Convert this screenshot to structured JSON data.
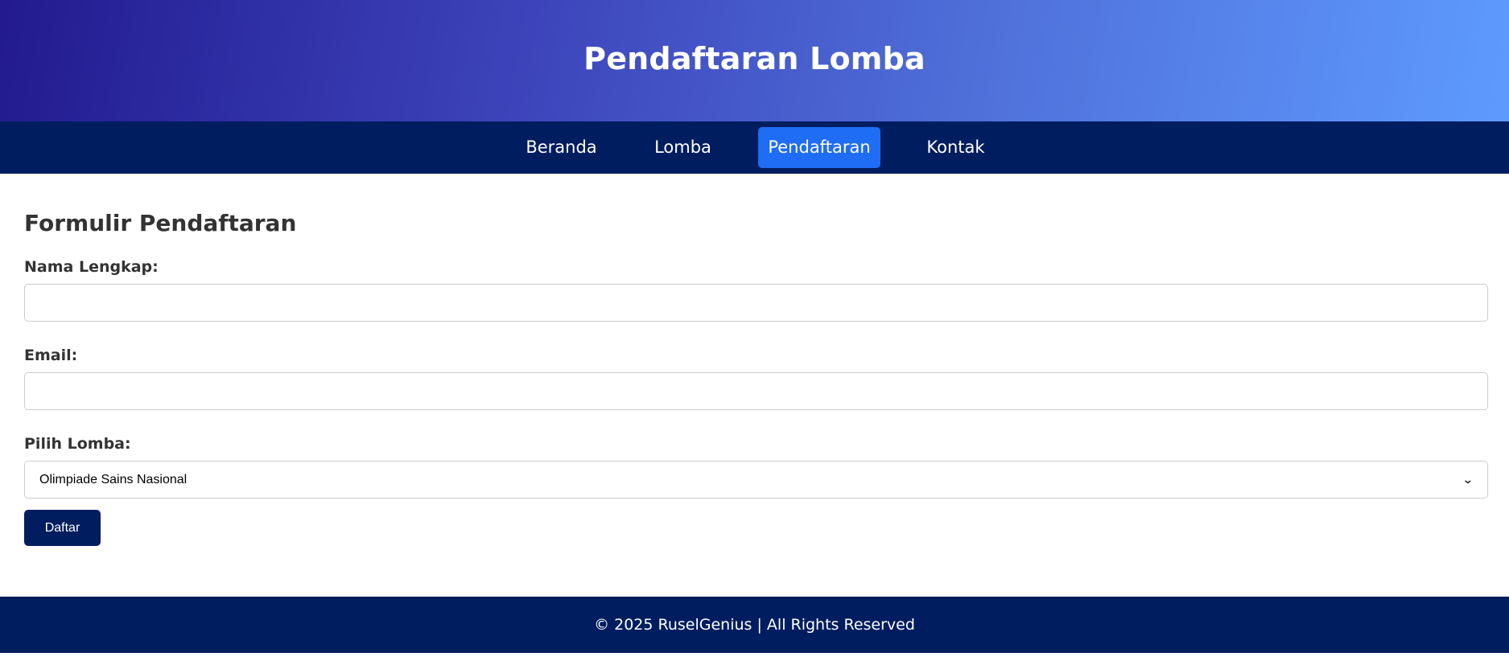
{
  "header": {
    "title": "Pendaftaran Lomba"
  },
  "nav": {
    "items": [
      {
        "label": "Beranda",
        "active": false
      },
      {
        "label": "Lomba",
        "active": false
      },
      {
        "label": "Pendaftaran",
        "active": true
      },
      {
        "label": "Kontak",
        "active": false
      }
    ]
  },
  "form": {
    "title": "Formulir Pendaftaran",
    "name_label": "Nama Lengkap:",
    "name_value": "",
    "email_label": "Email:",
    "email_value": "",
    "competition_label": "Pilih Lomba:",
    "competition_selected": "Olimpiade Sains Nasional",
    "submit_label": "Daftar"
  },
  "footer": {
    "text": "© 2025 RuselGenius | All Rights Reserved"
  },
  "colors": {
    "primary_dark": "#001d5f",
    "nav_active": "#1f6cf5",
    "header_gradient_start": "#221a8e",
    "header_gradient_end": "#5e9bff"
  },
  "icons": {
    "select_arrow": "chevron-down-icon"
  }
}
